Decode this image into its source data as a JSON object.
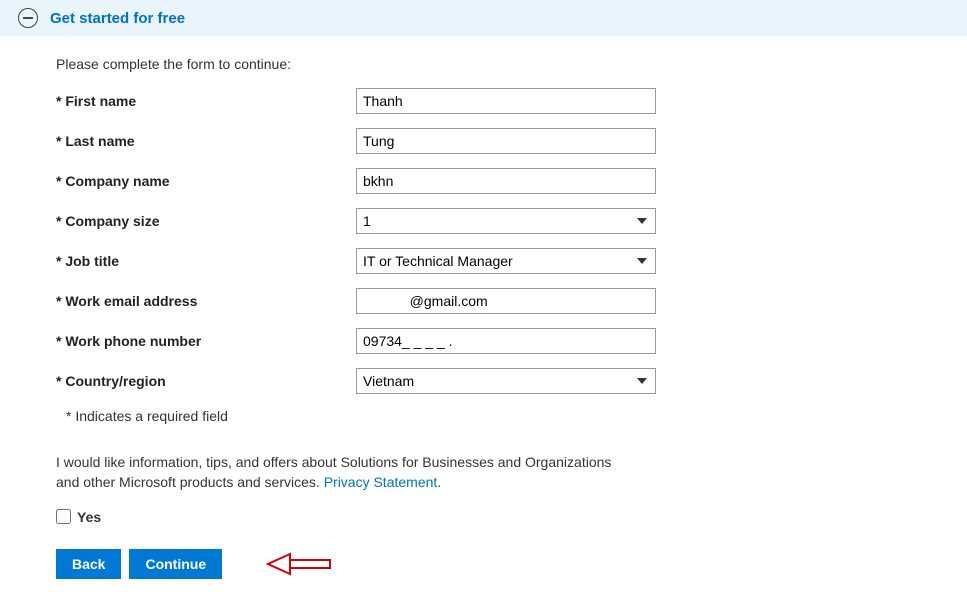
{
  "header": {
    "title": "Get started for free"
  },
  "form": {
    "intro": "Please complete the form to continue:",
    "fields": {
      "first_name": {
        "label": "* First name",
        "value": "Thanh"
      },
      "last_name": {
        "label": "* Last name",
        "value": "Tung"
      },
      "company_name": {
        "label": "* Company name",
        "value": "bkhn"
      },
      "company_size": {
        "label": "* Company size",
        "value": "1"
      },
      "job_title": {
        "label": "* Job title",
        "value": "IT or Technical Manager"
      },
      "work_email": {
        "label": "* Work email address",
        "value": "            @gmail.com"
      },
      "work_phone": {
        "label": "* Work phone number",
        "value": "09734_ _ _ _ ."
      },
      "country": {
        "label": "* Country/region",
        "value": "Vietnam"
      }
    },
    "required_note": "* Indicates a required field",
    "consent_text_a": "I would like information, tips, and offers about Solutions for Businesses and Organizations and other Microsoft products and services. ",
    "privacy_link": "Privacy Statement",
    "consent_checkbox_label": "Yes",
    "buttons": {
      "back": "Back",
      "continue": "Continue"
    }
  }
}
